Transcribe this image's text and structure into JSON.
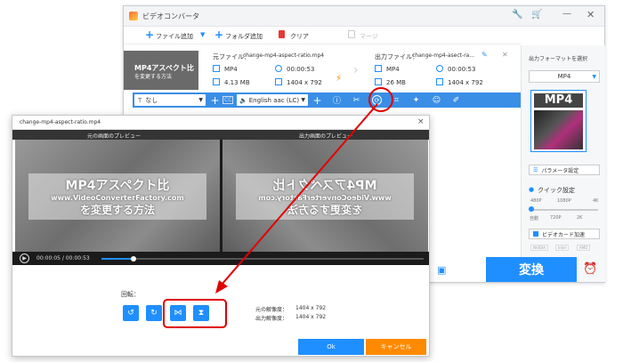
{
  "main_window": {
    "title": "ビデオコンバータ",
    "toolbar": {
      "add_file": "ファイル追加",
      "add_folder": "フォルダ追加",
      "clear": "クリア",
      "merge": "マージ"
    },
    "source": {
      "label": "元ファイル：",
      "name": "change-mp4-aspect-ratio.mp4",
      "format": "MP4",
      "duration": "00:00:53",
      "size": "4.13 MB",
      "resolution": "1404 x 792"
    },
    "output": {
      "label": "出力ファイル：",
      "name": "change-mp4-asect-ra...",
      "format": "MP4",
      "duration": "00:00:53",
      "size": "26 MB",
      "resolution": "1404 x 792"
    },
    "thumb_line1": "MP4アスペクト比",
    "thumb_line2": "を変更する方法",
    "subtitle": "なし",
    "audio": "English aac (LC)",
    "cc": "CC",
    "format_select_label": "出力フォーマットを選択",
    "format_value": "MP4",
    "format_icon_label": "MP4",
    "param_button": "パラメータ設定",
    "quick_label": "クイック設定",
    "quick_ticks_top": [
      "480P",
      "1080P",
      "4K"
    ],
    "quick_ticks_bottom": [
      "自動",
      "720P",
      "2K"
    ],
    "gpu_label": "ビデオカード加速",
    "gpu_vendors": [
      "NVIDIA",
      "Intel",
      "AMD"
    ],
    "convert": "変換"
  },
  "dialog": {
    "title": "change-mp4-aspect-ratio.mp4",
    "close": "×",
    "left_preview_label": "元の画面のプレビュー",
    "right_preview_label": "出力画面のプレビュー",
    "overlay_line1": "MP4アスペクト比",
    "overlay_line2": "www.VideoConverterFactory.com",
    "overlay_line3": "を変更する方法",
    "time": "00:00:05 / 00:00:53",
    "progress": 0.1,
    "rotate_label": "回転：",
    "src_res_label": "元の解像度：",
    "src_res": "1404 x 792",
    "out_res_label": "出力解像度：",
    "out_res": "1404 x 792",
    "ok": "Ok",
    "cancel": "キャンセル"
  },
  "colors": {
    "accent": "#1f8fff",
    "toolbar_blue": "#3a8ee6",
    "cancel_orange": "#ff8a00",
    "highlight_red": "#e00000"
  }
}
